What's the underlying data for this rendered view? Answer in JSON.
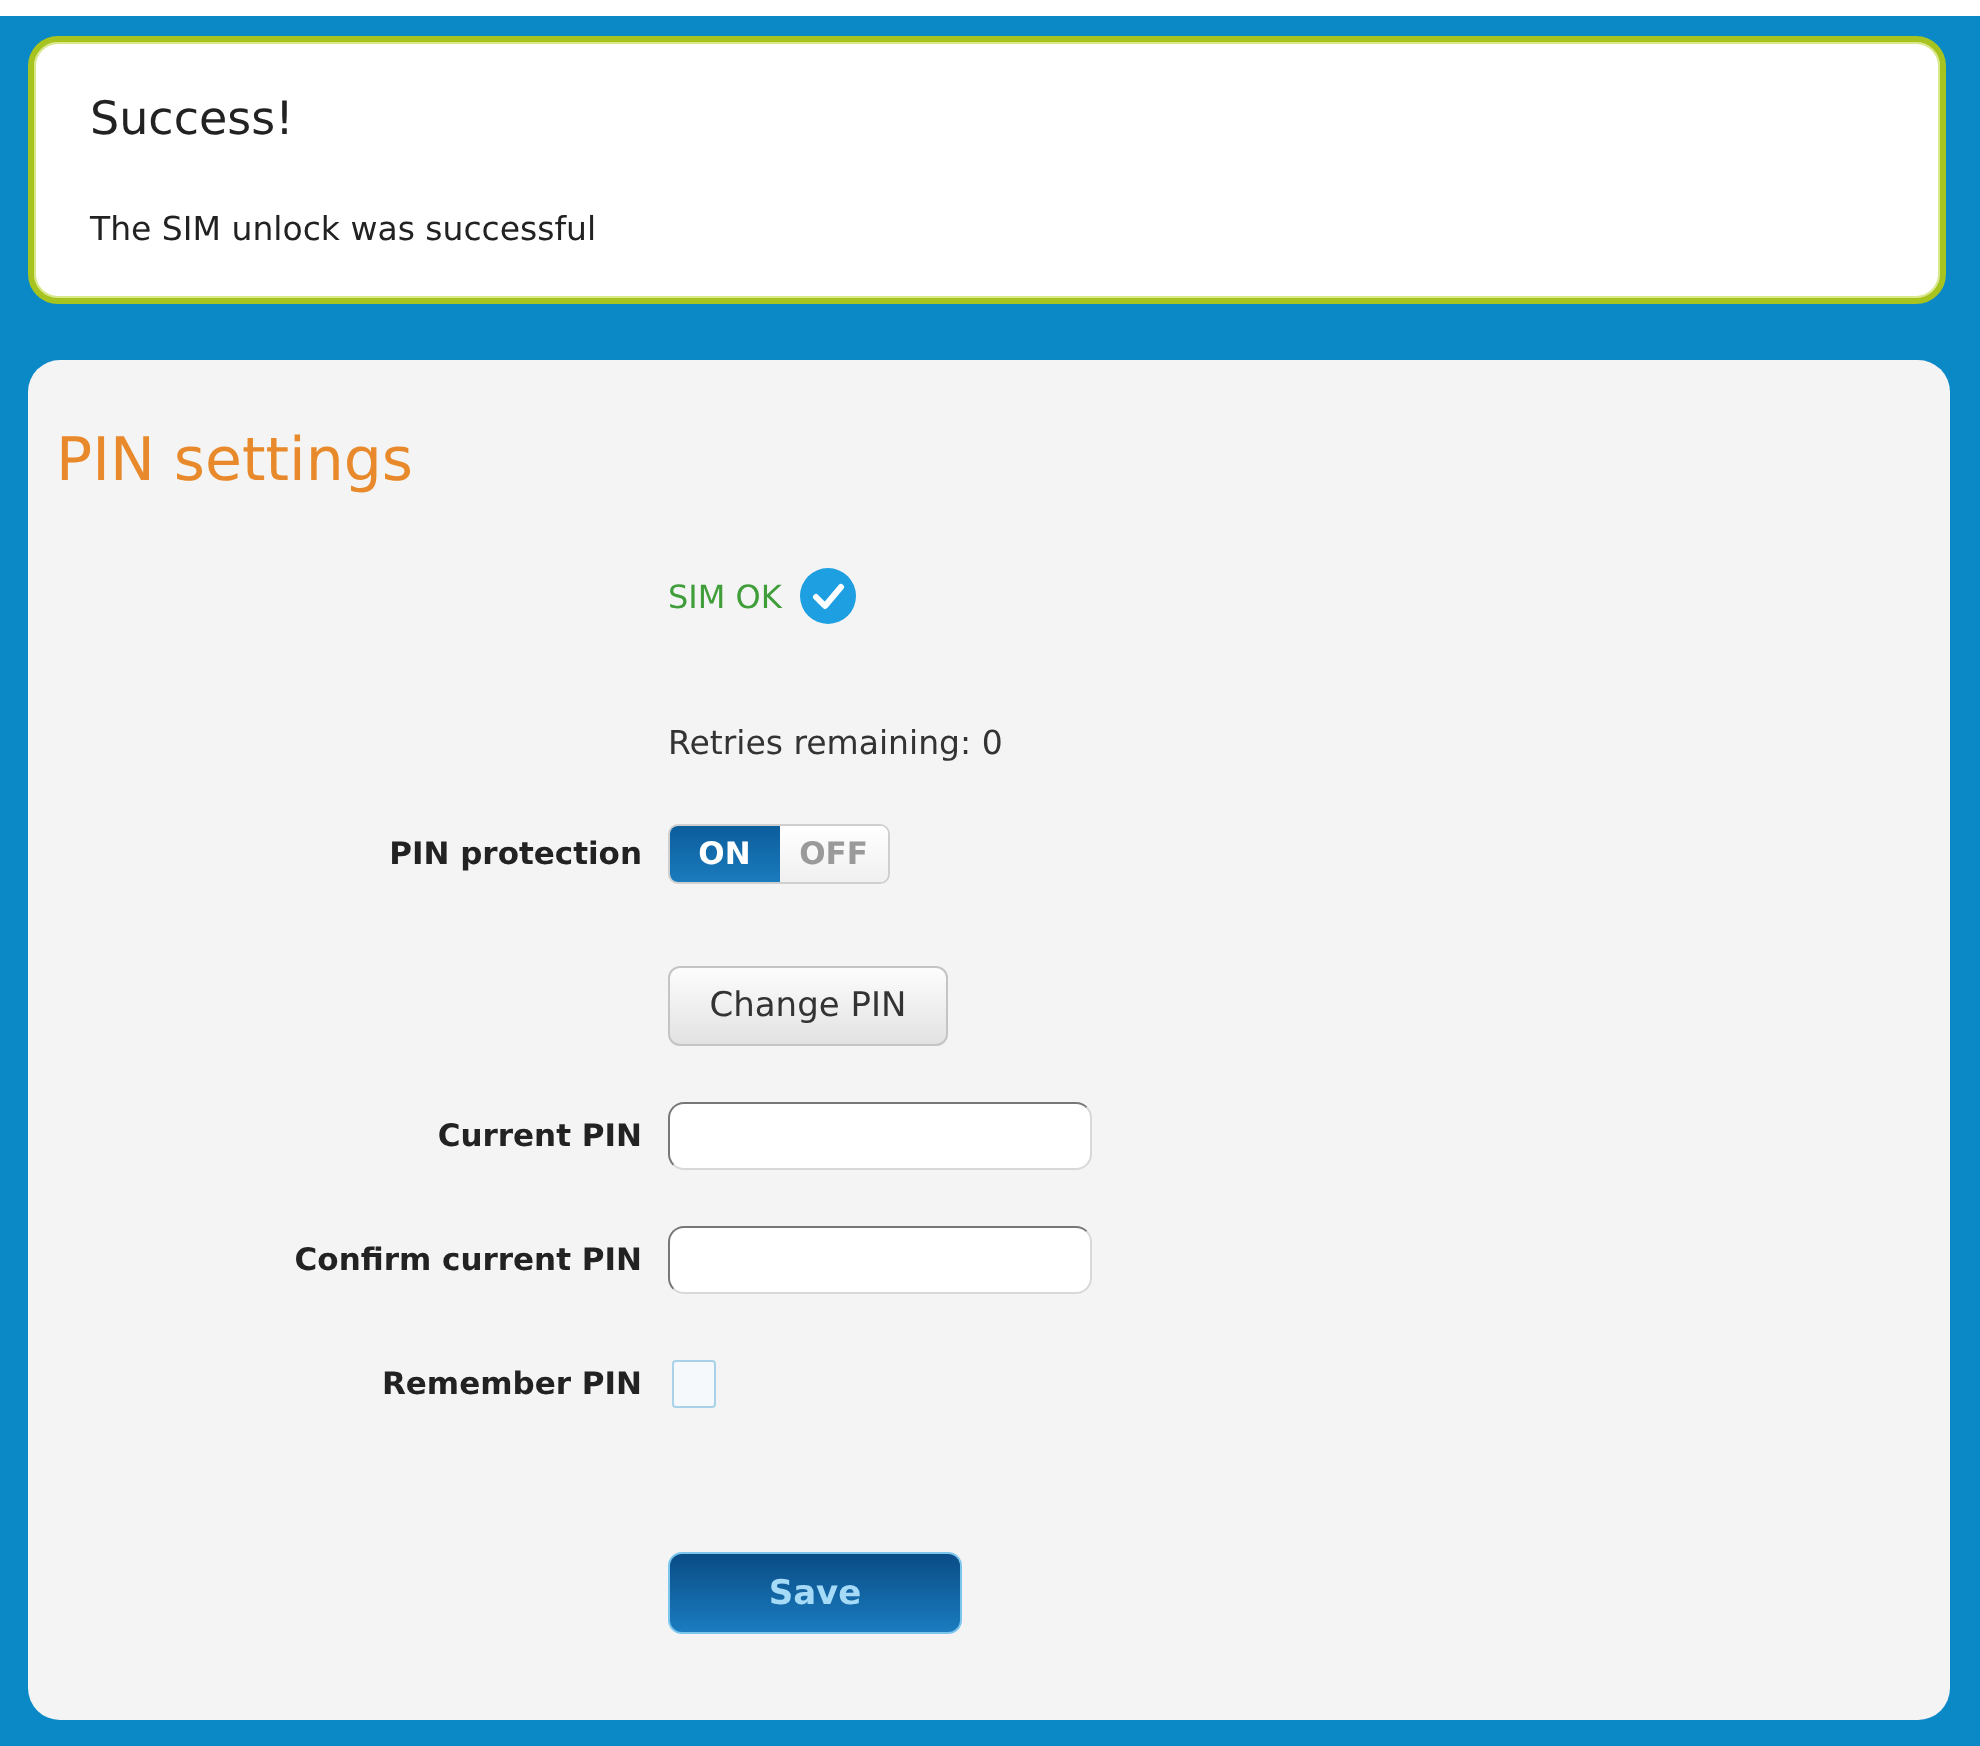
{
  "success_message": {
    "title": "Success!",
    "text": "The SIM unlock was successful"
  },
  "pin_settings": {
    "title": "PIN settings",
    "rows": [
      {
        "kind": "status",
        "text": "SIM OK"
      },
      {
        "kind": "note",
        "text": "Retries remaining: 0"
      },
      {
        "kind": "toggle",
        "label": "PIN protection",
        "on": true,
        "on_text": "ON",
        "off_text": "OFF"
      },
      {
        "kind": "button",
        "text": "Change PIN"
      },
      {
        "kind": "field",
        "label": "Current PIN"
      },
      {
        "kind": "field",
        "label": "Confirm current PIN"
      },
      {
        "kind": "checkbox",
        "label": "Remember PIN",
        "checked": false
      },
      {
        "kind": "submit",
        "text": "Save"
      }
    ]
  }
}
